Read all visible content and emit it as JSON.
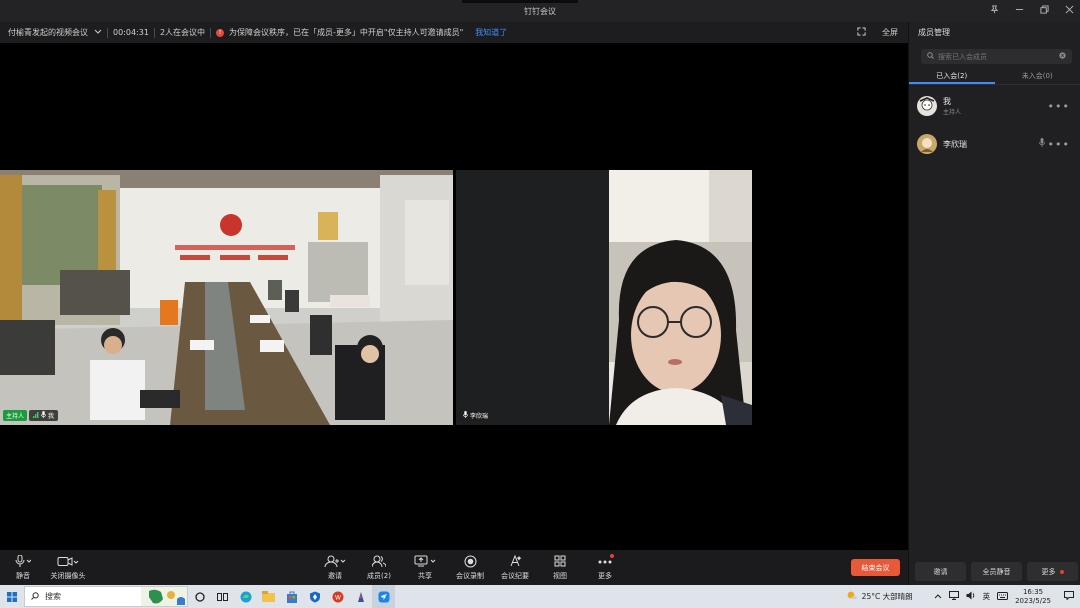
{
  "window": {
    "title": "钉钉会议"
  },
  "infobar": {
    "meeting_name": "付榆青发起的视频会议",
    "timer": "00:04:31",
    "participants": "2人在会议中",
    "notice": "为保障会议秩序，已在「成员-更多」中开启\"仅主持人可邀请成员\"",
    "known_link": "我知道了",
    "fullscreen_label": "全屏"
  },
  "tiles": {
    "main": {
      "host_badge": "主持人",
      "name": "我"
    },
    "second": {
      "name": "李欣瑞"
    }
  },
  "sidebar": {
    "title": "成员管理",
    "search_placeholder": "搜索已入会成员",
    "tabs": [
      "已入会(2)",
      "未入会(0)"
    ],
    "members": [
      {
        "name": "我",
        "role": "主持人"
      },
      {
        "name": "李欣瑞",
        "role": ""
      }
    ],
    "buttons": {
      "invite": "邀请",
      "mute_all": "全员静音",
      "more": "更多"
    }
  },
  "toolbar": {
    "mute": "静音",
    "camera": "关闭摄像头",
    "invite": "邀请",
    "members": "成员(2)",
    "share": "共享",
    "record": "会议录制",
    "minutes": "会议纪要",
    "view": "视图",
    "more": "更多",
    "end": "结束会议"
  },
  "taskbar": {
    "search_placeholder": "搜索",
    "weather": "25°C 大部晴朗",
    "ime": "英",
    "time": "16:35",
    "date": "2023/5/25"
  },
  "colors": {
    "accent": "#3f8cff",
    "end": "#e8593a",
    "host": "#1c9a3e",
    "warning": "#e2493b"
  }
}
